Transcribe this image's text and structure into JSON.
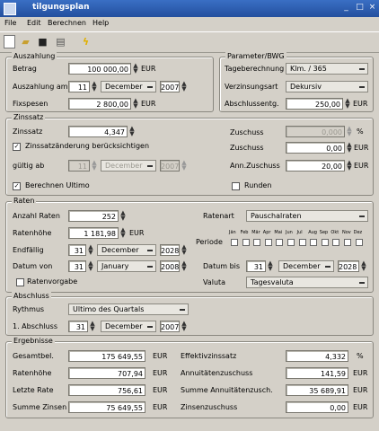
{
  "window": {
    "title": "tilgungsplan"
  },
  "menu": [
    "File",
    "Edit",
    "Berechnen",
    "Help"
  ],
  "toolbar": {
    "icons": [
      "new-icon",
      "open-icon",
      "save-icon",
      "print-icon",
      "calculate-icon"
    ]
  },
  "auszahlung": {
    "title": "Auszahlung",
    "betrag_label": "Betrag",
    "betrag_value": "100 000,00",
    "betrag_unit": "EUR",
    "auszahlung_am_label": "Auszahlung am",
    "day": "11",
    "month": "December",
    "year": "2007",
    "fixspesen_label": "Fixspesen",
    "fixspesen_value": "2 800,00",
    "fixspesen_unit": "EUR"
  },
  "parameter": {
    "title": "Parameter/BWG",
    "tageberechnung_label": "Tageberechnung",
    "tageberechnung_value": "Klm. / 365",
    "verzinsungsart_label": "Verzinsungsart",
    "verzinsungsart_value": "Dekursiv",
    "abschlussentg_label": "Abschlussentg.",
    "abschlussentg_value": "250,00",
    "abschlussentg_unit": "EUR"
  },
  "zinssatz": {
    "title": "Zinssatz",
    "zinssatz_label": "Zinssatz",
    "zinssatz_value": "4,347",
    "aenderung_label": "Zinssatzänderung berücksichtigen",
    "gueltig_ab_label": "gültig ab",
    "gueltig_day": "11",
    "gueltig_month": "December",
    "gueltig_year": "2007",
    "berechnen_ultimo_label": "Berechnen Ultimo",
    "zuschuss1_label": "Zuschuss",
    "zuschuss1_value": "0,000",
    "zuschuss1_unit": "%",
    "zuschuss2_label": "Zuschuss",
    "zuschuss2_value": "0,00",
    "zuschuss2_unit": "EUR",
    "annzuschuss_label": "Ann.Zuschuss",
    "annzuschuss_value": "20,00",
    "annzuschuss_unit": "EUR",
    "runden_label": "Runden"
  },
  "raten": {
    "title": "Raten",
    "anzahl_label": "Anzahl Raten",
    "anzahl_value": "252",
    "ratenhoehe_label": "Ratenhöhe",
    "ratenhoehe_value": "1 181,98",
    "ratenhoehe_unit": "EUR",
    "endfaellig_label": "Endfällig",
    "end_day": "31",
    "end_month": "December",
    "end_year": "2028",
    "datum_von_label": "Datum von",
    "von_day": "31",
    "von_month": "January",
    "von_year": "2008",
    "ratenvorgabe_label": "Ratenvorgabe",
    "ratenart_label": "Ratenart",
    "ratenart_value": "Pauschalraten",
    "periode_label": "Periode",
    "months": [
      "Jän",
      "Feb",
      "Mär",
      "Apr",
      "Mai",
      "Jun",
      "Jul",
      "Aug",
      "Sep",
      "Okt",
      "Nov",
      "Dez"
    ],
    "datum_bis_label": "Datum bis",
    "bis_day": "31",
    "bis_month": "December",
    "bis_year": "2028",
    "valuta_label": "Valuta",
    "valuta_value": "Tagesvaluta"
  },
  "abschluss": {
    "title": "Abschluss",
    "rhythmus_label": "Rythmus",
    "rhythmus_value": "Ultimo des Quartals",
    "erster_label": "1. Abschluss",
    "erster_day": "31",
    "erster_month": "December",
    "erster_year": "2007"
  },
  "ergebnisse": {
    "title": "Ergebnisse",
    "gesamtbel_label": "Gesamtbel.",
    "gesamtbel_value": "175 649,55",
    "gesamtbel_unit": "EUR",
    "ratenhoehe_label": "Ratenhöhe",
    "ratenhoehe_value": "707,94",
    "ratenhoehe_unit": "EUR",
    "letzte_label": "Letzte Rate",
    "letzte_value": "756,61",
    "letzte_unit": "EUR",
    "summe_zinsen_label": "Summe Zinsen",
    "summe_zinsen_value": "75 649,55",
    "summe_zinsen_unit": "EUR",
    "effektiv_label": "Effektivzinssatz",
    "effektiv_value": "4,332",
    "effektiv_unit": "%",
    "annuitaeten_label": "Annuitätenzuschuss",
    "annuitaeten_value": "141,59",
    "annuitaeten_unit": "EUR",
    "summe_ann_label": "Summe Annuitätenzusch.",
    "summe_ann_value": "35 689,91",
    "summe_ann_unit": "EUR",
    "zinsenzuschuss_label": "Zinsenzuschuss",
    "zinsenzuschuss_value": "0,00",
    "zinsenzuschuss_unit": "EUR"
  }
}
